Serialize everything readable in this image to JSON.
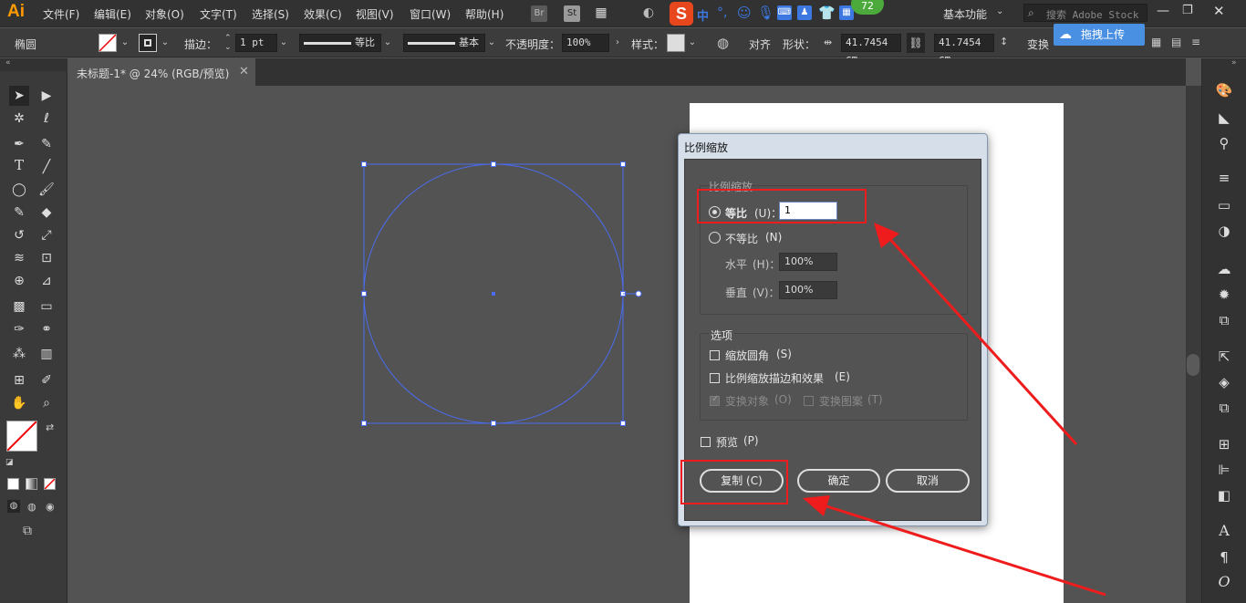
{
  "menubar": {
    "logo": "Ai",
    "items": [
      "文件(F)",
      "编辑(E)",
      "对象(O)",
      "文字(T)",
      "选择(S)",
      "效果(C)",
      "视图(V)",
      "窗口(W)",
      "帮助(H)"
    ],
    "br": "Br",
    "st": "St",
    "ime_label": "中",
    "badge": "72",
    "workspace": "基本功能",
    "search_placeholder": "搜索 Adobe Stock",
    "upload_label": "拖拽上传"
  },
  "options": {
    "selection_type": "椭圆",
    "stroke_label": "描边：",
    "stroke_value": "1 pt",
    "profile_label": "等比",
    "brush_label": "基本",
    "opacity_label": "不透明度：",
    "opacity_value": "100%",
    "style_label": "样式：",
    "align_label": "对齐",
    "shape_label": "形状：",
    "width_value": "41.7454 cm",
    "height_value": "41.7454 cm",
    "transform_label": "变换"
  },
  "document": {
    "tab_title": "未标题-1* @ 24% (RGB/预览)"
  },
  "dialog": {
    "title": "比例缩放",
    "group_label": "比例缩放",
    "uniform_label": "等比",
    "uniform_key": "(U)：",
    "uniform_value": "1",
    "nonuniform_label": "不等比",
    "nonuniform_key": "(N)",
    "horizontal_label": "水平",
    "horizontal_key": "(H)：",
    "horizontal_value": "100%",
    "vertical_label": "垂直",
    "vertical_key": "(V)：",
    "vertical_value": "100%",
    "options_label": "选项",
    "scale_corners_label": "缩放圆角",
    "scale_corners_key": "(S)",
    "scale_strokes_label": "比例缩放描边和效果",
    "scale_strokes_key": "(E)",
    "transform_objects_label": "变换对象",
    "transform_objects_key": "(O)",
    "transform_patterns_label": "变换图案",
    "transform_patterns_key": "(T)",
    "preview_label": "预览",
    "preview_key": "(P)",
    "copy_button": "复制",
    "copy_key": "(C)",
    "ok_button": "确定",
    "cancel_button": "取消"
  },
  "colors": {
    "accent_red": "#ee1c1c",
    "selection_blue": "#4a6cf0",
    "app_bg": "#535353"
  }
}
